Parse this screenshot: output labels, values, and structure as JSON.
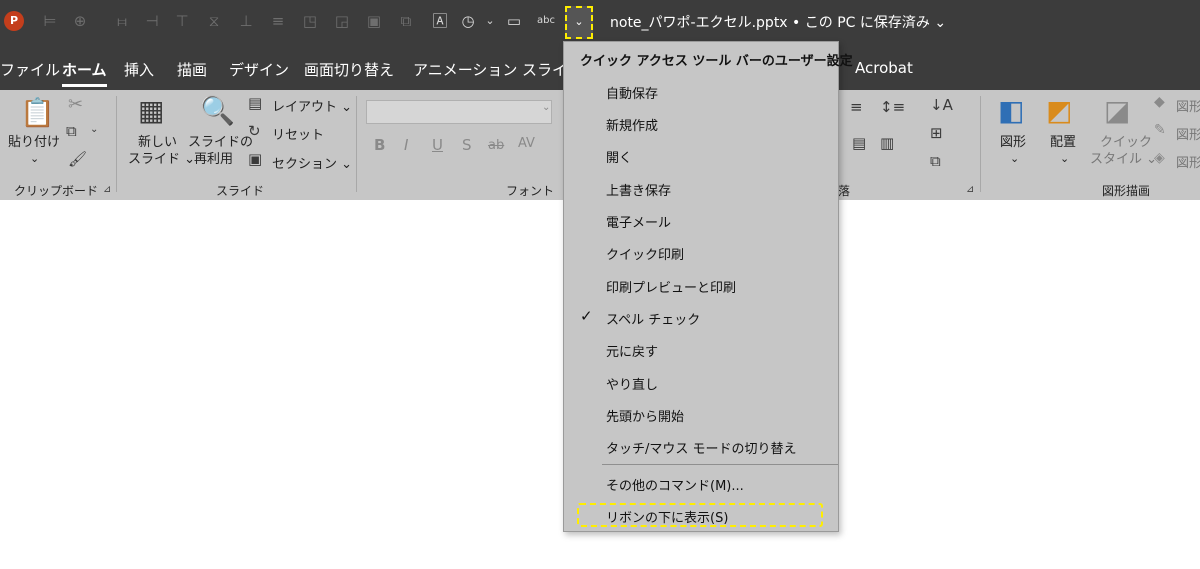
{
  "title_bar": {
    "document_title": "note_パワポ-エクセル.pptx • この PC に保存済み ⌄",
    "app_logo": "P",
    "qat_dropdown_glyph": "⌄"
  },
  "tabs": [
    "ファイル",
    "ホーム",
    "挿入",
    "描画",
    "デザイン",
    "画面切り替え",
    "アニメーション",
    "スライド",
    "Acrobat"
  ],
  "ribbon": {
    "clipboard": {
      "paste_label": "貼り付け",
      "paste_arrow": "⌄",
      "group_label": "クリップボード",
      "launcher": "⊿"
    },
    "slides": {
      "new_slide_label_1": "新しい",
      "new_slide_label_2": "スライド ⌄",
      "reuse_label_1": "スライドの",
      "reuse_label_2": "再利用",
      "layout": "レイアウト ⌄",
      "reset": "リセット",
      "section": "セクション ⌄",
      "group_label": "スライド"
    },
    "font": {
      "group_label": "フォント",
      "bold": "B",
      "italic": "I",
      "underline": "U",
      "shadow": "S",
      "strike": "ab",
      "spacing": "AV"
    },
    "paragraph": {
      "group_label": "落",
      "launcher": "⊿"
    },
    "drawing": {
      "shapes_label": "図形",
      "shapes_arrow": "⌄",
      "arrange_label": "配置",
      "arrange_arrow": "⌄",
      "quick_style_1": "クイック",
      "quick_style_2": "スタイル ⌄",
      "fill": "図形",
      "outline": "図形",
      "effects": "図形",
      "group_label": "図形描画"
    }
  },
  "qat_menu": {
    "header": "クイック アクセス ツール バーのユーザー設定",
    "items": [
      {
        "label": "自動保存",
        "checked": false
      },
      {
        "label": "新規作成",
        "checked": false
      },
      {
        "label": "開く",
        "checked": false
      },
      {
        "label": "上書き保存",
        "checked": false
      },
      {
        "label": "電子メール",
        "checked": false
      },
      {
        "label": "クイック印刷",
        "checked": false
      },
      {
        "label": "印刷プレビューと印刷",
        "checked": false
      },
      {
        "label": "スペル チェック",
        "checked": true
      },
      {
        "label": "元に戻す",
        "checked": false
      },
      {
        "label": "やり直し",
        "checked": false
      },
      {
        "label": "先頭から開始",
        "checked": false
      },
      {
        "label": "タッチ/マウス モードの切り替え",
        "checked": false
      }
    ],
    "more_commands": "その他のコマンド(M)...",
    "show_below_ribbon": "リボンの下に表示(S)",
    "check_glyph": "✓"
  },
  "colors": {
    "titlebar_bg": "#3c3c3c",
    "ribbon_bg": "#c6c6c6",
    "highlight": "#ffee00",
    "app_logo": "#c43e1c"
  }
}
